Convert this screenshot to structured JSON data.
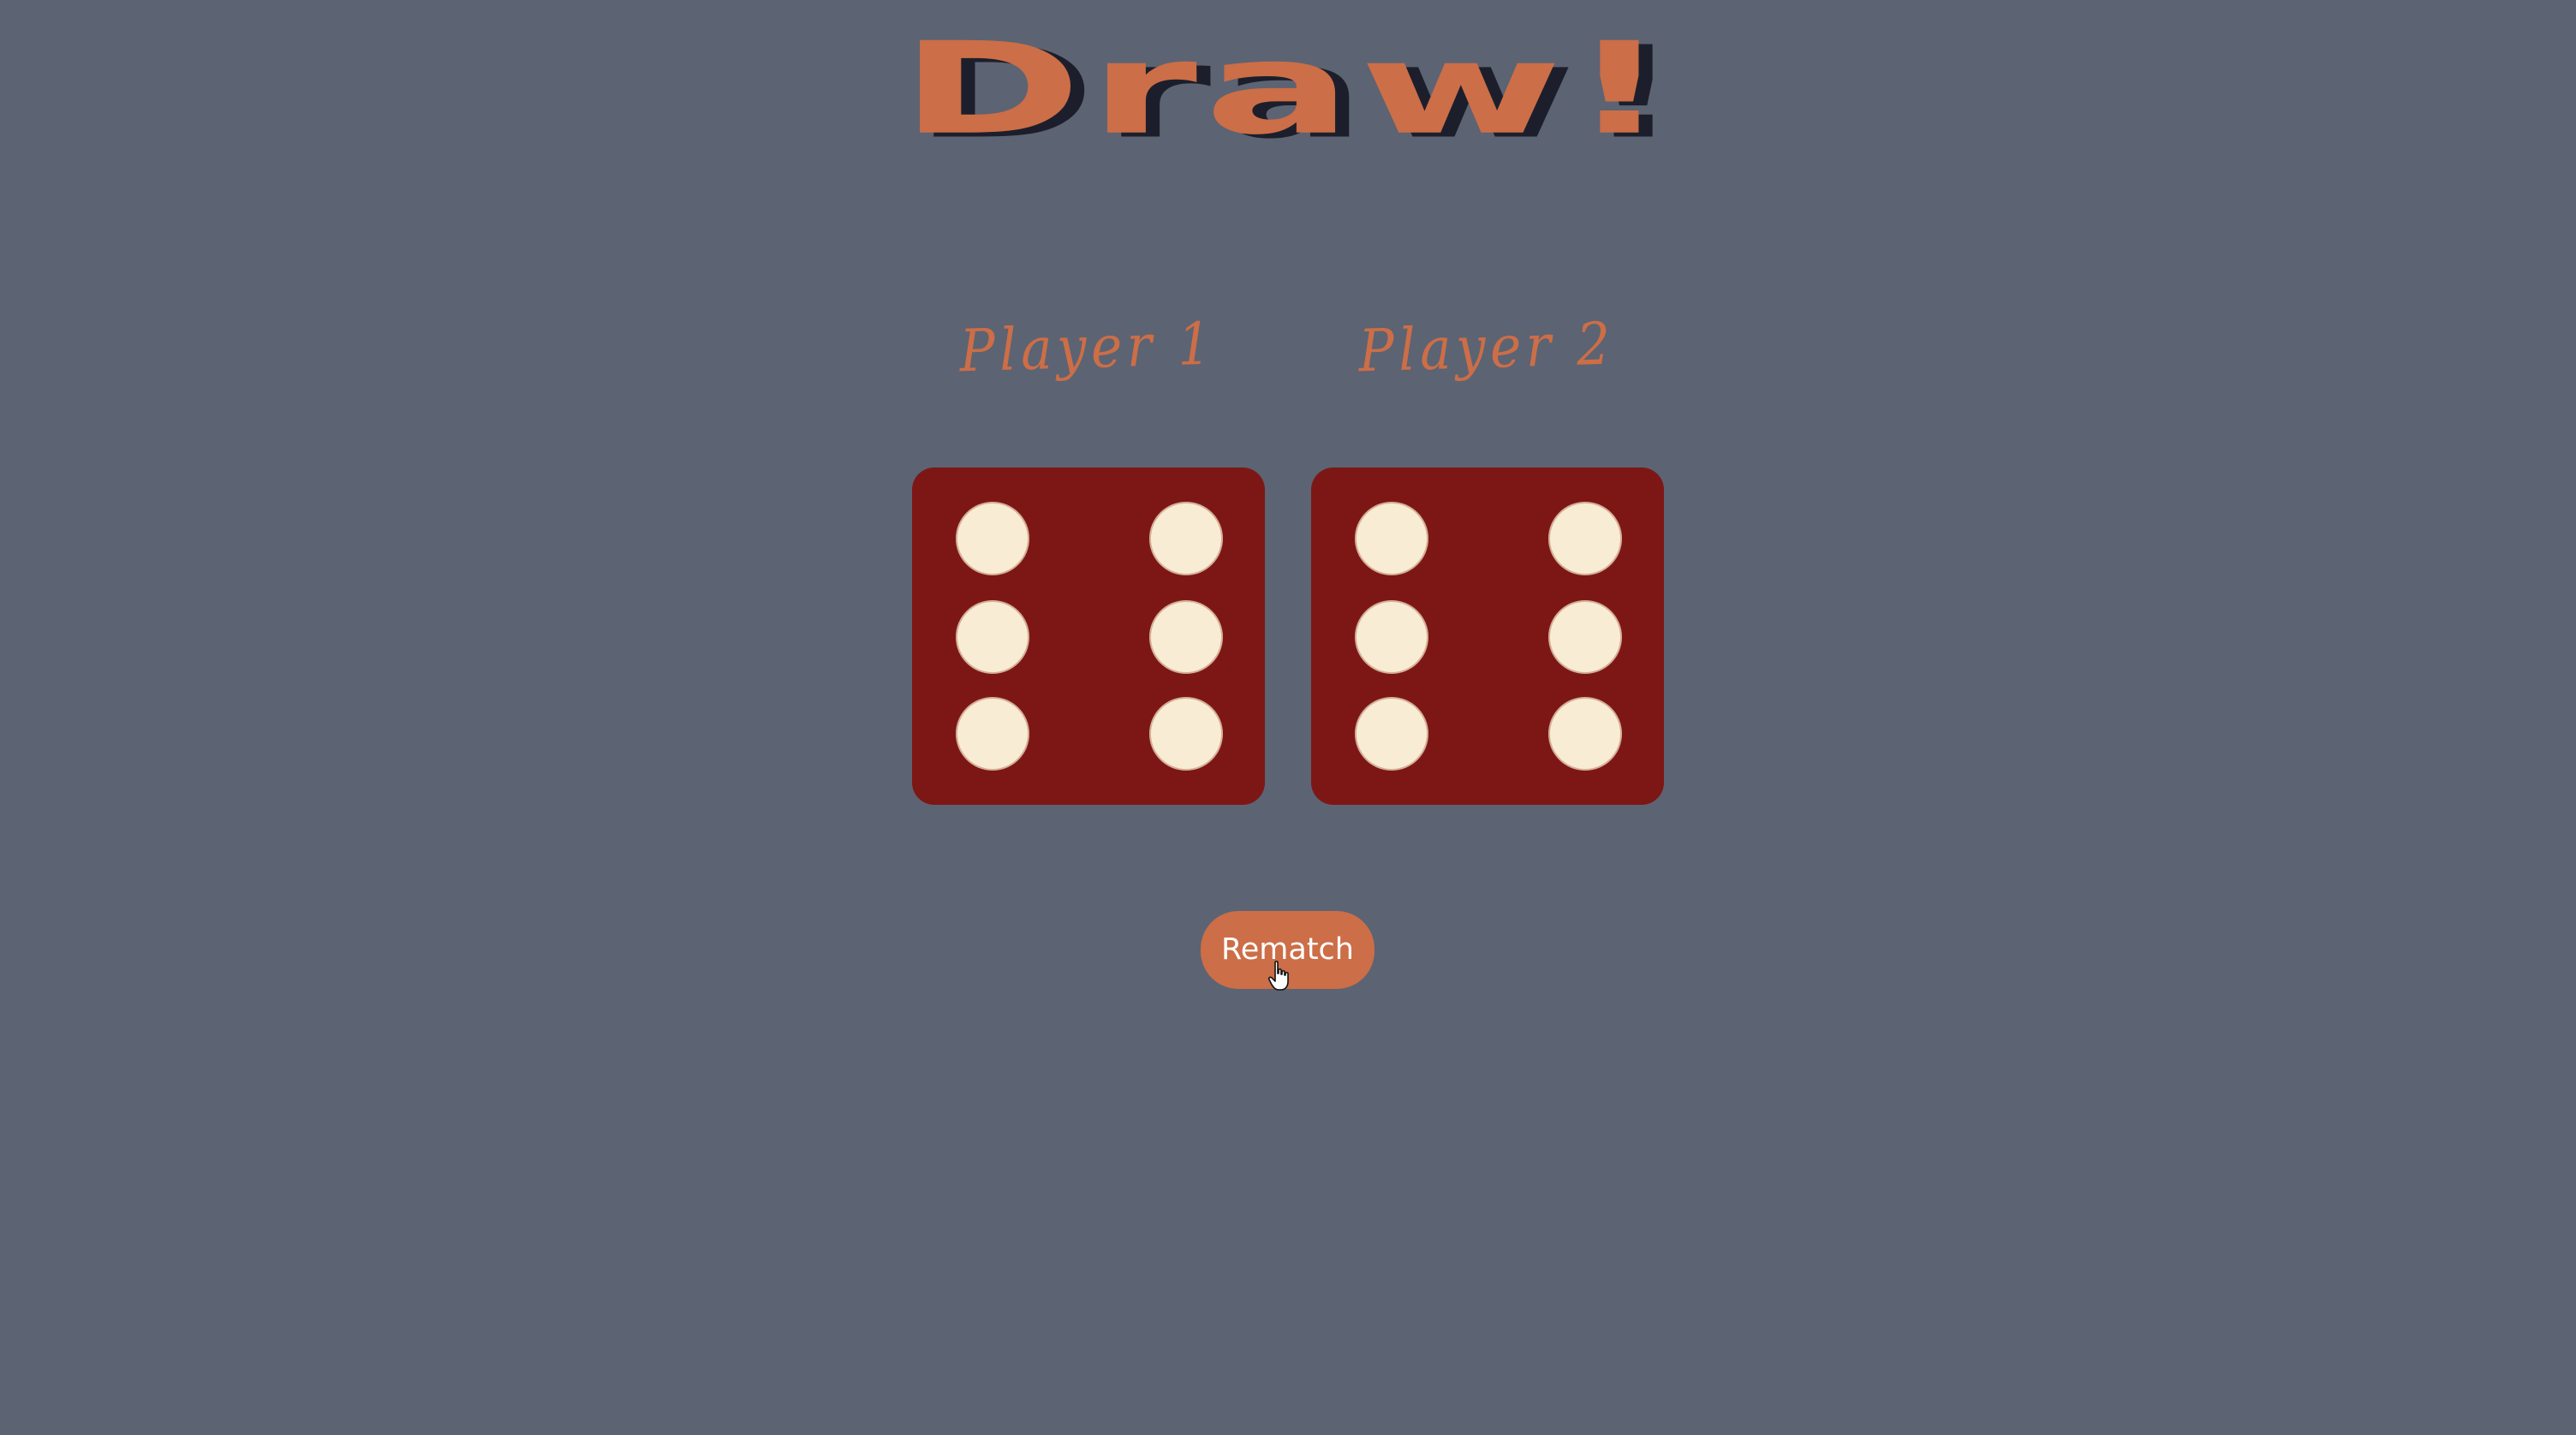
{
  "header": {
    "title": "Draw!"
  },
  "players": [
    {
      "label": "Player 1",
      "die_value": 6
    },
    {
      "label": "Player 2",
      "die_value": 6
    }
  ],
  "actions": {
    "rematch_label": "Rematch"
  },
  "colors": {
    "background": "#5c6373",
    "accent": "#cc6e47",
    "title_shadow": "#1c1f2b",
    "die_face": "#7d1716",
    "pip": "#f8edd4",
    "button_text": "#ffffff"
  },
  "icons": {
    "cursor": "hand-pointer-icon",
    "die_pip": "circle-pip"
  }
}
